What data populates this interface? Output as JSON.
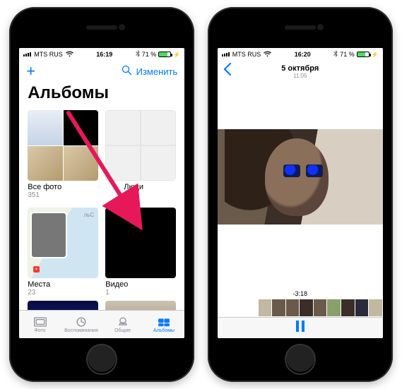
{
  "statusbar": {
    "carrier": "MTS RUS",
    "wifi_icon": "wifi",
    "battery_pct": "71 %",
    "bluetooth": "bt"
  },
  "left": {
    "time": "16:19",
    "nav": {
      "add_icon": "plus",
      "search_icon": "search",
      "edit_label": "Изменить"
    },
    "title": "Альбомы",
    "albums": [
      {
        "name": "Все фото",
        "count": "351"
      },
      {
        "name": "Люди",
        "count": ""
      },
      {
        "name": "Места",
        "count": "23"
      },
      {
        "name": "Видео",
        "count": "1"
      }
    ],
    "album_map_label": "льС",
    "tabs": [
      {
        "label": "Фото"
      },
      {
        "label": "Воспоминания"
      },
      {
        "label": "Общие"
      },
      {
        "label": "Альбомы"
      }
    ]
  },
  "right": {
    "time": "16:20",
    "header": {
      "back_icon": "chevron-left",
      "date": "5 октября",
      "subtime": "11:05"
    },
    "player": {
      "remaining": "-3:18",
      "pause_icon": "pause"
    }
  }
}
